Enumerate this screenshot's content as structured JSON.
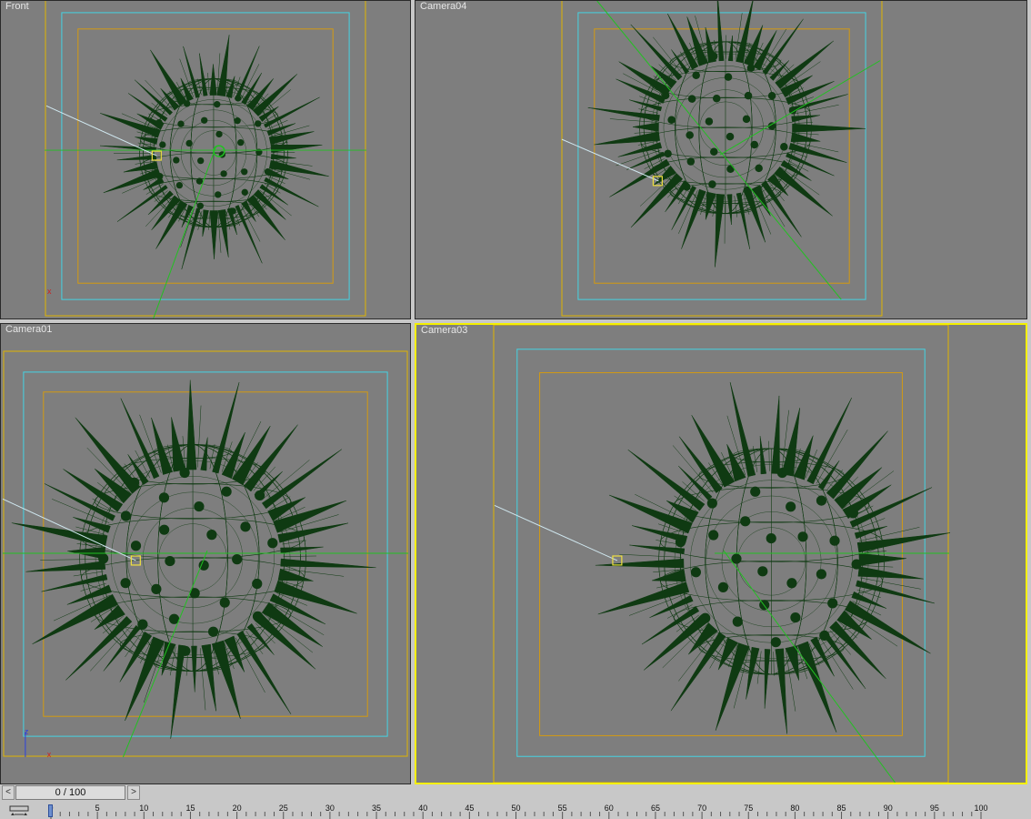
{
  "viewports": [
    {
      "id": "front",
      "label": "Front",
      "active": false
    },
    {
      "id": "cam04",
      "label": "Camera04",
      "active": false
    },
    {
      "id": "cam01",
      "label": "Camera01",
      "active": false
    },
    {
      "id": "cam03",
      "label": "Camera03",
      "active": true
    }
  ],
  "time_slider": {
    "label": "0 / 100",
    "prev": "<",
    "next": ">"
  },
  "timeline": {
    "ticks": [
      "0",
      "5",
      "10",
      "15",
      "20",
      "25",
      "30",
      "35",
      "40",
      "45",
      "50",
      "55",
      "60",
      "65",
      "70",
      "75",
      "80",
      "85",
      "90",
      "95",
      "100"
    ],
    "current_frame": "0"
  },
  "axis_labels": {
    "z": "z",
    "x": "x"
  },
  "colors": {
    "viewport_bg": "#7e7e7e",
    "active_border": "#f4f000",
    "safe_outer": "#e0b400",
    "safe_action": "#44d4e4",
    "safe_title": "#d49a10",
    "mesh": "#0f3a12",
    "grid_line": "#22c022",
    "light_line": "#d0e8f0",
    "target_box": "#f0e040"
  }
}
